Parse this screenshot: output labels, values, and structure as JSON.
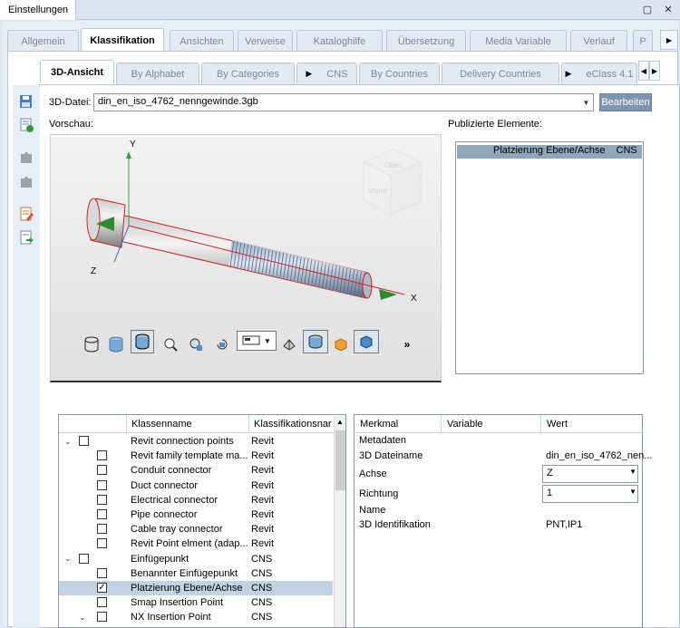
{
  "window": {
    "tab": "Einstellungen"
  },
  "main_tabs": [
    {
      "label": "Allgemein",
      "active": false
    },
    {
      "label": "Klassifikation",
      "active": true
    },
    {
      "label": "Ansichten",
      "active": false
    },
    {
      "label": "Verweise",
      "active": false
    },
    {
      "label": "Kataloghilfe",
      "active": false
    },
    {
      "label": "Übersetzung",
      "active": false
    },
    {
      "label": "Media Variable",
      "active": false
    },
    {
      "label": "Verlauf",
      "active": false
    },
    {
      "label": "P",
      "active": false
    }
  ],
  "sub_tabs": [
    {
      "label": "3D-Ansicht",
      "active": true
    },
    {
      "label": "By Alphabet",
      "active": false
    },
    {
      "label": "By Categories",
      "active": false
    },
    {
      "label": "CNS",
      "active": false,
      "arrow": true
    },
    {
      "label": "By Countries",
      "active": false
    },
    {
      "label": "Delivery Countries",
      "active": false
    },
    {
      "label": "eClass 4.1",
      "active": false,
      "arrow": true
    }
  ],
  "file": {
    "label": "3D-Datei:",
    "value": "din_en_iso_4762_nenngewinde.3gb",
    "edit_button": "Bearbeiten"
  },
  "preview": {
    "label": "Vorschau:",
    "axes": {
      "y": "Y",
      "x": "X",
      "z": "Z"
    },
    "cube": {
      "top": "Oben",
      "front": "Vorne"
    },
    "more": "»"
  },
  "published": {
    "label": "Publizierte Elemente:",
    "row": {
      "name": "Platzierung Ebene/Achse",
      "class": "CNS"
    }
  },
  "class_tree": {
    "headers": {
      "name": "Klassenname",
      "class": "Klassifikationsnar"
    },
    "rows": [
      {
        "name": "Revit connection points",
        "class": "Revit",
        "level": 0,
        "expanded": true,
        "checked": false,
        "selected": false
      },
      {
        "name": "Revit family template ma...",
        "class": "Revit",
        "level": 1,
        "checked": false,
        "selected": false
      },
      {
        "name": "Conduit connector",
        "class": "Revit",
        "level": 1,
        "checked": false,
        "selected": false
      },
      {
        "name": "Duct connector",
        "class": "Revit",
        "level": 1,
        "checked": false,
        "selected": false
      },
      {
        "name": "Electrical connector",
        "class": "Revit",
        "level": 1,
        "checked": false,
        "selected": false
      },
      {
        "name": "Pipe connector",
        "class": "Revit",
        "level": 1,
        "checked": false,
        "selected": false
      },
      {
        "name": "Cable tray connector",
        "class": "Revit",
        "level": 1,
        "checked": false,
        "selected": false
      },
      {
        "name": "Revit Point elment (adap...",
        "class": "Revit",
        "level": 1,
        "checked": false,
        "selected": false
      },
      {
        "name": "Einfügepunkt",
        "class": "CNS",
        "level": 0,
        "expanded": true,
        "checked": false,
        "selected": false
      },
      {
        "name": "Benannter Einfügepunkt",
        "class": "CNS",
        "level": 1,
        "checked": false,
        "selected": false
      },
      {
        "name": "Platzierung Ebene/Achse",
        "class": "CNS",
        "level": 1,
        "checked": true,
        "selected": true
      },
      {
        "name": "Smap Insertion Point",
        "class": "CNS",
        "level": 1,
        "checked": false,
        "selected": false
      },
      {
        "name": "NX Insertion Point",
        "class": "CNS",
        "level": 1,
        "expanded": true,
        "checked": false,
        "selected": false
      }
    ]
  },
  "properties": {
    "headers": {
      "feature": "Merkmal",
      "variable": "Variable",
      "value": "Wert"
    },
    "metadata": "Metadaten",
    "rows": [
      {
        "name": "3D Dateiname",
        "value": "din_en_iso_4762_nen...",
        "type": "text"
      },
      {
        "name": "Achse",
        "value": "Z",
        "type": "combo"
      },
      {
        "name": "Richtung",
        "value": "1",
        "type": "combo"
      },
      {
        "name": "Name",
        "value": "",
        "type": "text"
      },
      {
        "name": "3D Identifikation",
        "value": "PNT,IP1",
        "type": "text"
      }
    ]
  }
}
